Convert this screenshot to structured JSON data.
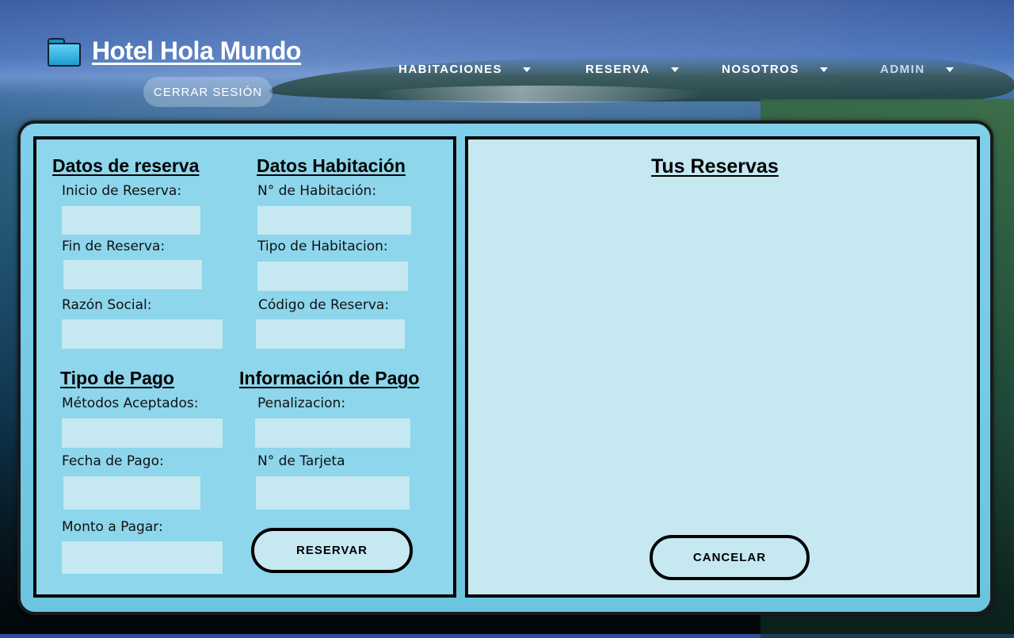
{
  "brand": {
    "name": "Hotel Hola Mundo",
    "icon": "folder-icon"
  },
  "header": {
    "logout_label": "CERRAR SESIÓN"
  },
  "nav": {
    "items": [
      {
        "label": "HABITACIONES"
      },
      {
        "label": "RESERVA"
      },
      {
        "label": "NOSOTROS"
      },
      {
        "label": "ADMIN"
      }
    ]
  },
  "booking": {
    "datos_reserva": {
      "title": "Datos de reserva",
      "inicio_label": "Inicio de Reserva:",
      "fin_label": "Fin de Reserva:",
      "razon_label": "Razón Social:"
    },
    "datos_habitacion": {
      "title": "Datos Habitación",
      "numero_label": "N° de Habitación:",
      "tipo_label": "Tipo de Habitacion:",
      "codigo_label": "Código de Reserva:"
    },
    "tipo_pago": {
      "title": "Tipo de Pago",
      "metodos_label": "Métodos Aceptados:",
      "fecha_label": "Fecha de Pago:",
      "monto_label": "Monto a Pagar:"
    },
    "info_pago": {
      "title": "Información de Pago",
      "penalizacion_label": "Penalizacion:",
      "tarjeta_label": "N° de Tarjeta"
    },
    "submit_label": "RESERVAR"
  },
  "reservations": {
    "title": "Tus Reservas",
    "cancel_label": "CANCELAR"
  }
}
